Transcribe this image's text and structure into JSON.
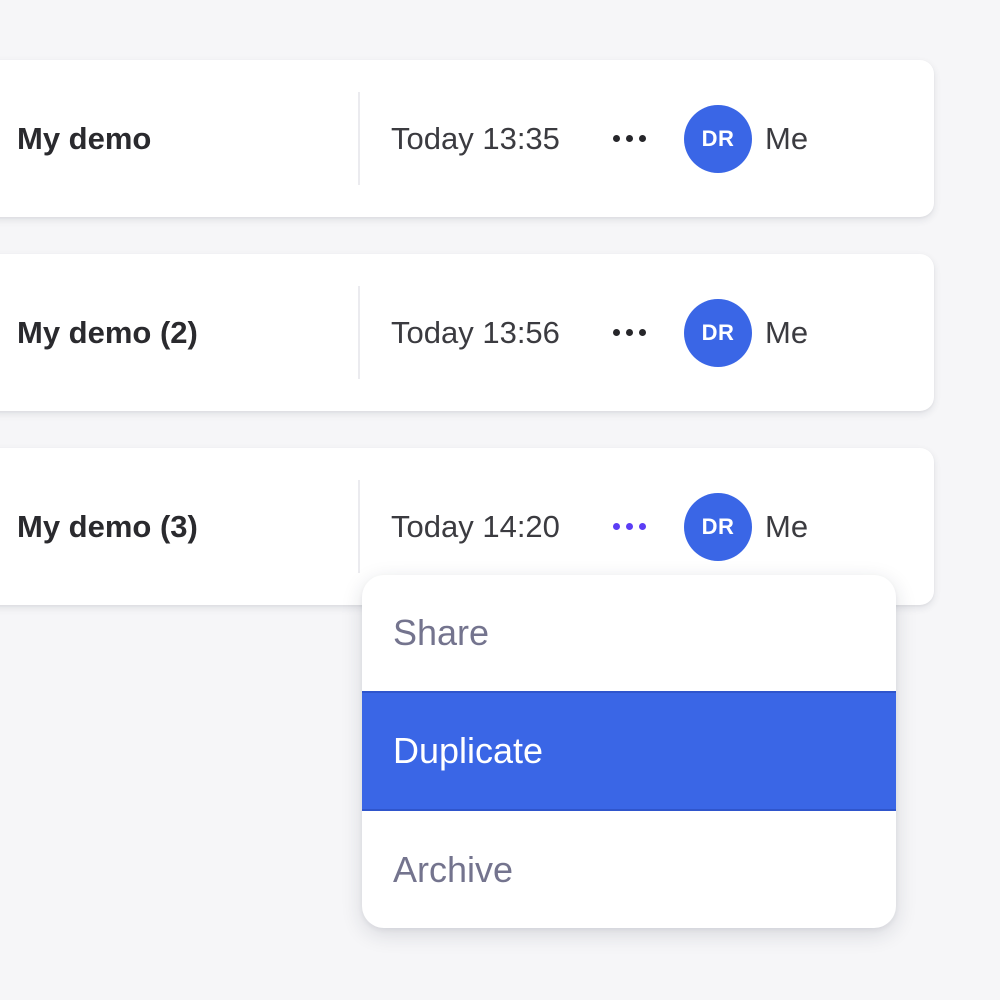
{
  "rows": [
    {
      "name": "My demo",
      "time": "Today 13:35",
      "avatar_initials": "DR",
      "owner": "Me",
      "menu_icon": "more-horizontal-icon"
    },
    {
      "name": "My demo (2)",
      "time": "Today 13:56",
      "avatar_initials": "DR",
      "owner": "Me",
      "menu_icon": "more-horizontal-icon"
    },
    {
      "name": "My demo (3)",
      "time": "Today 14:20",
      "avatar_initials": "DR",
      "owner": "Me",
      "menu_icon": "more-horizontal-icon"
    }
  ],
  "context_menu": {
    "items": [
      {
        "label": "Share"
      },
      {
        "label": "Duplicate",
        "highlighted": true
      },
      {
        "label": "Archive"
      }
    ]
  },
  "colors": {
    "accent": "#3a66e6",
    "active_dots": "#5b3df5",
    "background": "#f6f6f8",
    "menu_text": "#74748e"
  }
}
